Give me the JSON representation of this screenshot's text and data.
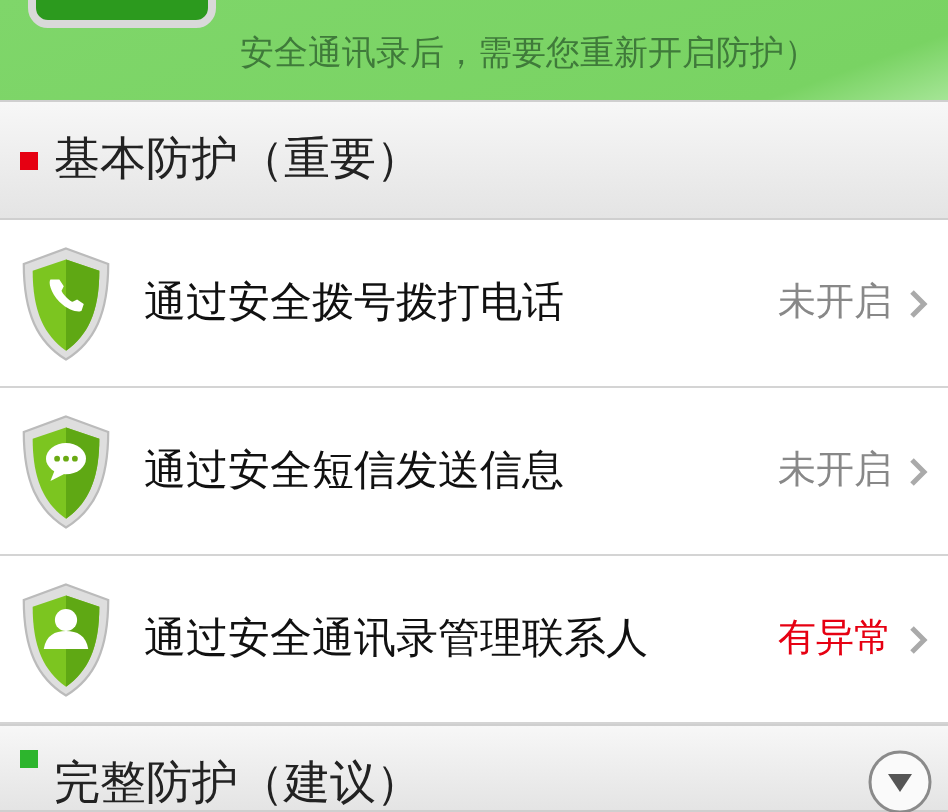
{
  "banner": {
    "lines": [
      "安全通讯录后，需要您重新开启防护）"
    ]
  },
  "sections": [
    {
      "title": "基本防护（重要）",
      "color": "#e60012",
      "collapsible": false,
      "items": [
        {
          "kind": "phone",
          "label": "通过安全拨号拨打电话",
          "status": "未开启",
          "color": "#888888"
        },
        {
          "kind": "chat",
          "label": "通过安全短信发送信息",
          "status": "未开启",
          "color": "#888888"
        },
        {
          "kind": "contact",
          "label": "通过安全通讯录管理联系人",
          "status": "有异常",
          "color": "#e60012"
        }
      ]
    },
    {
      "title": "完整防护（建议）",
      "color": "#2db52d",
      "collapsible": true
    }
  ]
}
